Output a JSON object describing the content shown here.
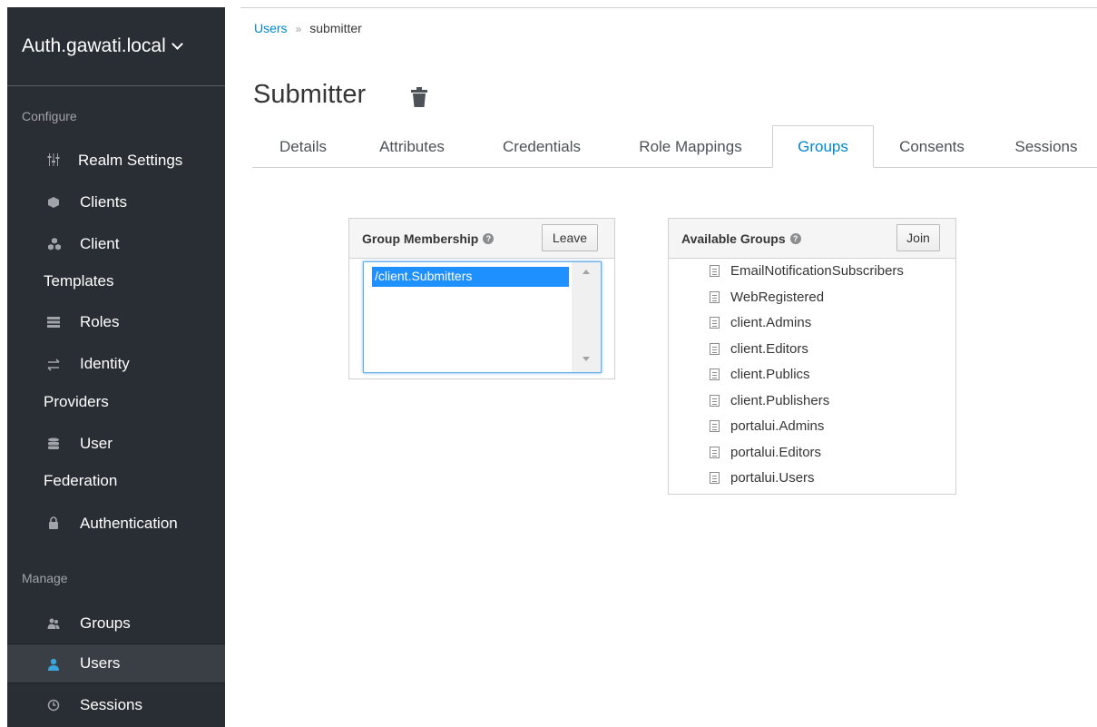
{
  "sidebar": {
    "realm": "Auth.gawati.local",
    "configure_label": "Configure",
    "manage_label": "Manage",
    "configure_items": [
      {
        "line1": "Realm Settings",
        "line2": "",
        "icon": "sliders-icon"
      },
      {
        "line1": "Clients",
        "line2": "",
        "icon": "cube-icon"
      },
      {
        "line1": "Client",
        "line2": "Templates",
        "icon": "cubes-icon"
      },
      {
        "line1": "Roles",
        "line2": "",
        "icon": "list-icon"
      },
      {
        "line1": "Identity",
        "line2": "Providers",
        "icon": "exchange-icon"
      },
      {
        "line1": "User",
        "line2": "Federation",
        "icon": "database-icon"
      },
      {
        "line1": "Authentication",
        "line2": "",
        "icon": "lock-icon"
      }
    ],
    "manage_items": [
      {
        "label": "Groups",
        "icon": "users-icon"
      },
      {
        "label": "Users",
        "icon": "user-icon"
      },
      {
        "label": "Sessions",
        "icon": "clock-icon"
      }
    ]
  },
  "breadcrumb": {
    "parent": "Users",
    "current": "submitter"
  },
  "page_title": "Submitter",
  "tabs": [
    "Details",
    "Attributes",
    "Credentials",
    "Role Mappings",
    "Groups",
    "Consents",
    "Sessions"
  ],
  "active_tab": "Groups",
  "group_membership": {
    "title": "Group Membership",
    "button": "Leave",
    "items": [
      "/client.Submitters"
    ]
  },
  "available_groups": {
    "title": "Available Groups",
    "button": "Join",
    "items": [
      "EmailNotificationSubscribers",
      "WebRegistered",
      "client.Admins",
      "client.Editors",
      "client.Publics",
      "client.Publishers",
      "portalui.Admins",
      "portalui.Editors",
      "portalui.Users"
    ]
  },
  "colors": {
    "sidebar_bg": "#292e34",
    "link": "#0088ce",
    "active_icon": "#39a5dc",
    "selection": "#1e90ff"
  }
}
